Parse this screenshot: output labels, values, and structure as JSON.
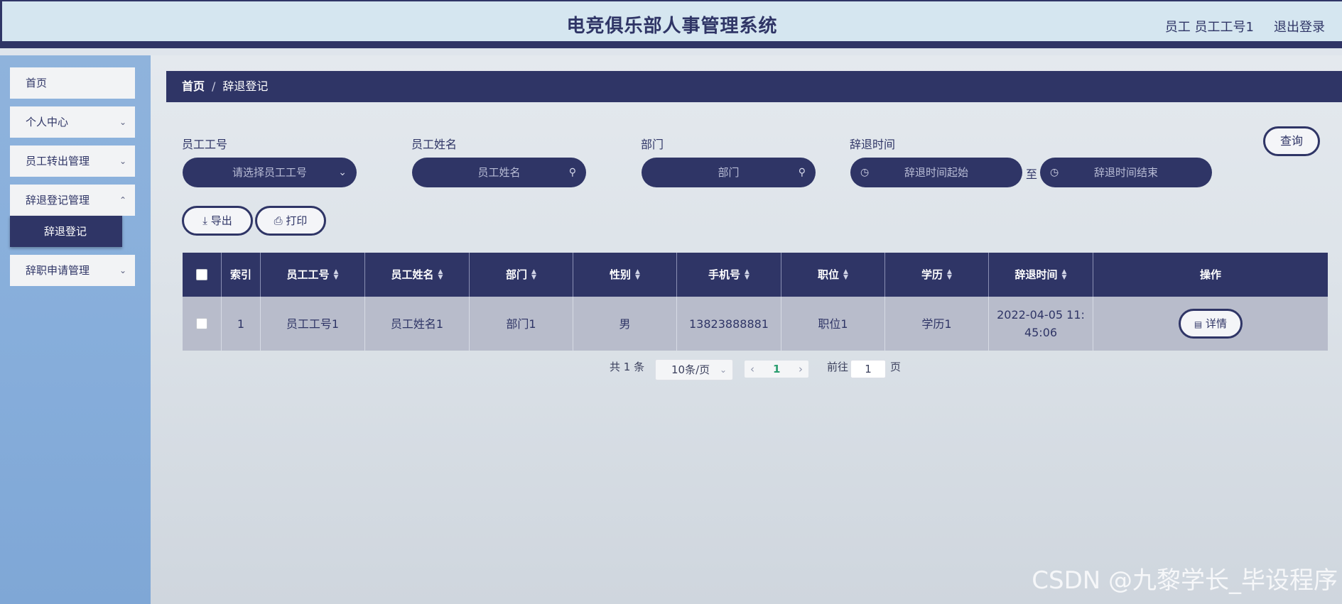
{
  "header": {
    "title": "电竞俱乐部人事管理系统",
    "user": "员工 员工工号1",
    "logout": "退出登录"
  },
  "sidebar": {
    "items": [
      {
        "label": "首页"
      },
      {
        "label": "个人中心"
      },
      {
        "label": "员工转出管理"
      },
      {
        "label": "辞退登记管理"
      },
      {
        "label": "辞退登记"
      },
      {
        "label": "辞职申请管理"
      }
    ]
  },
  "breadcrumb": {
    "home": "首页",
    "sep": "/",
    "current": "辞退登记"
  },
  "search": {
    "emp_no_label": "员工工号",
    "emp_no_placeholder": "请选择员工工号",
    "emp_name_label": "员工姓名",
    "emp_name_placeholder": "员工姓名",
    "dept_label": "部门",
    "dept_placeholder": "部门",
    "time_label": "辞退时间",
    "time_start_placeholder": "辞退时间起始",
    "time_to": "至",
    "time_end_placeholder": "辞退时间结束",
    "query_button": "查询"
  },
  "actions": {
    "export": "导出",
    "print": "打印"
  },
  "table": {
    "headers": [
      "索引",
      "员工工号",
      "员工姓名",
      "部门",
      "性别",
      "手机号",
      "职位",
      "学历",
      "辞退时间",
      "操作"
    ],
    "rows": [
      {
        "index": "1",
        "emp_no": "员工工号1",
        "emp_name": "员工姓名1",
        "dept": "部门1",
        "gender": "男",
        "phone": "13823888881",
        "position": "职位1",
        "edu": "学历1",
        "time": "2022-04-05 11:45:06",
        "action": "详情"
      }
    ]
  },
  "pager": {
    "total": "共 1 条",
    "page_size": "10条/页",
    "current_page": "1",
    "goto_label": "前往",
    "goto_value": "1",
    "page_unit": "页"
  },
  "watermark": "CSDN @九黎学长_毕设程序"
}
